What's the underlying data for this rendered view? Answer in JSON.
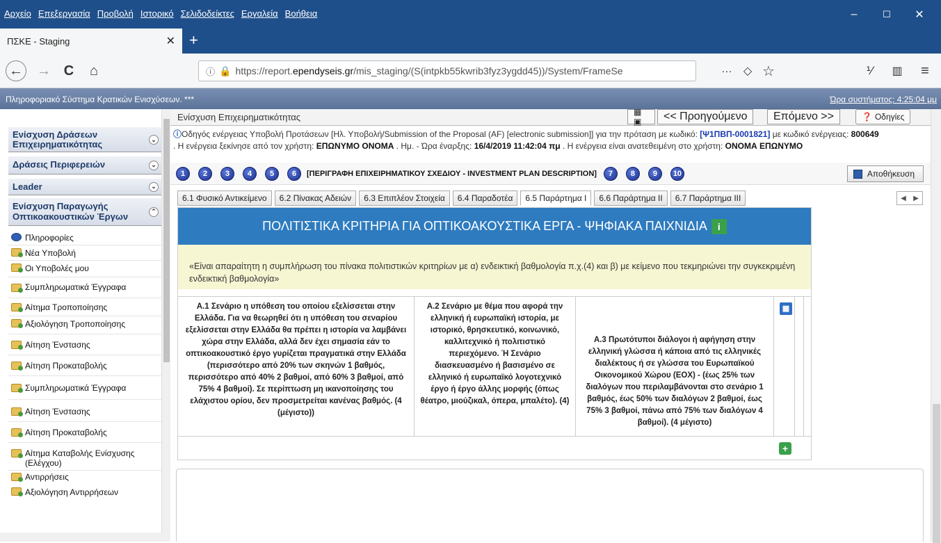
{
  "menu": [
    "Αρχείο",
    "Επεξεργασία",
    "Προβολή",
    "Ιστορικό",
    "Σελιδοδείκτες",
    "Εργαλεία",
    "Βοήθεια"
  ],
  "window_controls": {
    "minimize": "–",
    "maximize": "☐",
    "close": "✕"
  },
  "browser_tab": {
    "title": "ΠΣΚΕ - Staging",
    "close": "✕",
    "new": "+"
  },
  "nav": {
    "back": "←",
    "forward": "→",
    "reload": "C",
    "home": "⌂",
    "url_prefix": "https://report.",
    "url_domain": "ependyseis.gr",
    "url_rest": "/mis_staging/(S(intpkb55kwrib3fyz3ygdd45))/System/FrameSe",
    "more": "···",
    "pocket": "◇",
    "star": "☆",
    "library": "⅟",
    "sidebar": "▥",
    "menu": "≡"
  },
  "app": {
    "title": "Πληροφοριακό Σύστημα Κρατικών Ενισχύσεων. ***",
    "clock": "Ώρα συστήματος: 4:25:04 μμ"
  },
  "sidebar": {
    "categories": [
      {
        "label": "Ενίσχυση Δράσεων Επιχειρηματικότητας"
      },
      {
        "label": "Δράσεις Περιφερειών"
      },
      {
        "label": "Leader"
      },
      {
        "label": "Ενίσχυση Παραγωγής Οπτικοακουστικών Έργων"
      }
    ],
    "items": [
      "Πληροφορίες",
      "Νέα Υποβολή",
      "Οι Υποβολές μου",
      "Συμπληρωματικά Έγγραφα",
      "Αίτημα Τροποποίησης",
      "Αξιολόγηση Τροποποίησης",
      "Αίτηση Ένστασης",
      "Αίτηση Προκαταβολής",
      "Συμπληρωματικά Έγγραφα",
      "Αίτηση Ένστασης",
      "Αίτηση Προκαταβολής",
      "Αίτημα Καταβολής Ενίσχυσης (Ελέγχου)",
      "Αντιρρήσεις",
      "Αξιολόγηση Αντιρρήσεων"
    ]
  },
  "topstrip": {
    "crumb": "Ενίσχυση Επιχειρηματικότητας",
    "prev": "<< Προηγούμενο",
    "next": "Επόμενο >>",
    "help": "Οδηγίες"
  },
  "info": {
    "l1a": "Οδηγός ενέργειας Υποβολή Προτάσεων [Ηλ. Υποβολή/Submission of the Proposal (AF) [electronic submission]] για την πρόταση με κωδικό: ",
    "code": "[Ψ1ΠΒΠ-0001821]",
    "l1b": " με κωδικό ενέργειας: ",
    "action_code": "800649",
    "l2a": ". Η ενέργεια ξεκίνησε από τον χρήστη: ",
    "user": "ΕΠΩΝΥΜΟ ΟΝΟΜΑ",
    "l2b": " . Ημ. - Ώρα έναρξης: ",
    "start": "16/4/2019 11:42:04 πμ",
    "l2c": " . Η ενέργεια είναι ανατεθειμένη στο χρήστη: ",
    "assignee": "ΟΝΟΜΑ ΕΠΩΝΥΜΟ"
  },
  "steps": {
    "before": [
      "1",
      "2",
      "3",
      "4",
      "5",
      "6"
    ],
    "label": "[ΠΕΡΙΓΡΑΦΗ ΕΠΙΧΕΙΡΗΜΑΤΙΚΟΥ ΣΧΕΔΙΟΥ - INVESTMENT PLAN DESCRIPTION]",
    "after": [
      "7",
      "8",
      "9",
      "10"
    ],
    "save": "Αποθήκευση"
  },
  "subtabs": [
    "6.1 Φυσικό Αντικείμενο",
    "6.2 Πίνακας Αδειών",
    "6.3 Επιπλέον Στοιχεία",
    "6.4 Παραδοτέα",
    "6.5 Παράρτημα Ι",
    "6.6 Παράρτημα ΙΙ",
    "6.7 Παράρτημα ΙΙΙ"
  ],
  "active_subtab": 4,
  "panel": {
    "title": "ΠΟΛΙΤΙΣΤΙΚΑ ΚΡΙΤΗΡΙΑ ΓΙΑ ΟΠΤΙΚΟΑΚΟΥΣΤΙΚΑ ΕΡΓΑ - ΨΗΦΙΑΚΑ ΠΑΙΧΝΙΔΙΑ",
    "notice": "«Είναι απαραίτητη η συμπλήρωση του πίνακα πολιτιστικών κριτηρίων με α) ενδεικτική βαθμολογία π.χ.(4) και β) με κείμενο που τεκμηριώνει την συγκεκριμένη ενδεικτική βαθμολογία»",
    "criteria": [
      "Α.1 Σενάριο η υπόθεση του οποίου εξελίσσεται στην Ελλάδα. Για να θεωρηθεί ότι η υπόθεση του σεναρίου εξελίσσεται στην Ελλάδα θα πρέπει η ιστορία να λαμβάνει χώρα στην Ελλάδα, αλλά δεν έχει σημασία εάν το οπτικοακουστικό έργο γυρίζεται πραγματικά στην Ελλάδα (περισσότερο από 20% των σκηνών 1 βαθμός, περισσότερο από 40% 2 βαθμοί, από 60% 3 βαθμοί, από 75% 4 βαθμοί). Σε περίπτωση μη ικανοποίησης του ελάχιστου ορίου, δεν προσμετρείται κανένας βαθμός. (4 (μέγιστο))",
      "Α.2 Σενάριο με θέμα που αφορά την ελληνική ή ευρωπαϊκή ιστορία, με ιστορικό, θρησκευτικό, κοινωνικό, καλλιτεχνικό ή πολιτιστικό περιεχόμενο. Ή Σενάριο διασκευασμένο ή βασισμένο σε ελληνικό ή ευρωπαϊκό λογοτεχνικό έργο ή έργο άλλης μορφής (όπως θέατρο, μιούζικαλ, όπερα, μπαλέτο). (4)",
      "Α.3 Πρωτότυποι διάλογοι ή αφήγηση στην ελληνική γλώσσα ή κάποια από τις ελληνικές διαλέκτους ή σε γλώσσα του Ευρωπαϊκού Οικονομικού Χώρου (ΕΟΧ) - (έως 25% των διαλόγων που περιλαμβάνονται στο σενάριο 1 βαθμός, έως 50% των διαλόγων 2 βαθμοί, έως 75% 3 βαθμοί, πάνω από 75% των διαλόγων 4 βαθμοί). (4 μέγιστο)"
    ]
  }
}
